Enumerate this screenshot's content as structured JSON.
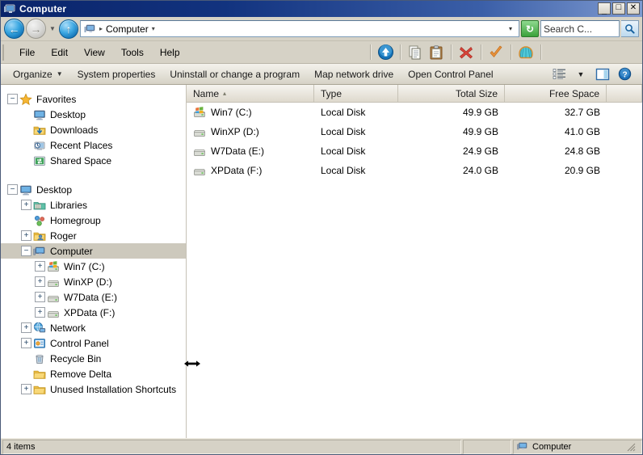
{
  "window": {
    "title": "Computer",
    "title_icon": "computer-monitor-icon",
    "minimize_label": "_",
    "maximize_label": "□",
    "close_label": "✕"
  },
  "address_bar": {
    "back_label": "←",
    "back_name": "back-button",
    "forward_label": "→",
    "forward_name": "forward-button",
    "history_caret": "▼",
    "up_label": "↑",
    "up_name": "up-button",
    "path_icon": "computer-monitor-icon",
    "crumb_sep": "▸",
    "crumb": "Computer",
    "crumb_caret": "▾",
    "dropdown_caret": "▾",
    "refresh_label": "↻",
    "search_value": "Search C...",
    "search_placeholder": "Search Computer",
    "search_button_icon": "magnifier-icon"
  },
  "menu": {
    "items": [
      {
        "label": "File",
        "name": "menu-file"
      },
      {
        "label": "Edit",
        "name": "menu-edit"
      },
      {
        "label": "View",
        "name": "menu-view"
      },
      {
        "label": "Tools",
        "name": "menu-tools"
      },
      {
        "label": "Help",
        "name": "menu-help"
      }
    ],
    "toolbar_icons": [
      {
        "name": "up-folder-icon",
        "glyph": "↑"
      },
      {
        "name": "copy-icon",
        "glyph": "❐"
      },
      {
        "name": "paste-icon",
        "glyph": "ὌB"
      },
      {
        "name": "delete-icon",
        "glyph": "✕"
      },
      {
        "name": "checkmark-icon",
        "glyph": "✓"
      },
      {
        "name": "shell-icon",
        "glyph": "◑"
      }
    ]
  },
  "command_bar": {
    "items": [
      {
        "label": "Organize",
        "name": "organize-button",
        "caret": "▼"
      },
      {
        "label": "System properties",
        "name": "system-properties-button",
        "caret": ""
      },
      {
        "label": "Uninstall or change a program",
        "name": "uninstall-program-button",
        "caret": ""
      },
      {
        "label": "Map network drive",
        "name": "map-network-drive-button",
        "caret": ""
      },
      {
        "label": "Open Control Panel",
        "name": "open-control-panel-button",
        "caret": ""
      }
    ],
    "view_icon": "view-list-icon",
    "view_caret": "▼",
    "preview_icon": "preview-pane-icon",
    "help_icon": "help-icon",
    "help_glyph": "?"
  },
  "nav_pane": {
    "items": [
      {
        "label": "Favorites",
        "name": "tree-item-favorites",
        "icon": "star-icon",
        "expander": "−",
        "indent": 0,
        "selected": false
      },
      {
        "label": "Desktop",
        "name": "tree-item-desktop-favorite",
        "icon": "desktop-icon",
        "expander": "",
        "indent": 1,
        "selected": false
      },
      {
        "label": "Downloads",
        "name": "tree-item-downloads",
        "icon": "downloads-folder-icon",
        "expander": "",
        "indent": 1,
        "selected": false
      },
      {
        "label": "Recent Places",
        "name": "tree-item-recent-places",
        "icon": "recent-places-icon",
        "expander": "",
        "indent": 1,
        "selected": false
      },
      {
        "label": "Shared Space",
        "name": "tree-item-shared-space",
        "icon": "shared-folder-icon",
        "expander": "",
        "indent": 1,
        "selected": false
      },
      {
        "label": "",
        "name": "tree-spacer",
        "icon": "",
        "expander": "",
        "indent": 0,
        "selected": false
      },
      {
        "label": "Desktop",
        "name": "tree-item-desktop-root",
        "icon": "desktop-icon",
        "expander": "−",
        "indent": 0,
        "selected": false
      },
      {
        "label": "Libraries",
        "name": "tree-item-libraries",
        "icon": "libraries-icon",
        "expander": "+",
        "indent": 1,
        "selected": false
      },
      {
        "label": "Homegroup",
        "name": "tree-item-homegroup",
        "icon": "homegroup-icon",
        "expander": "",
        "indent": 1,
        "selected": false
      },
      {
        "label": "Roger",
        "name": "tree-item-roger",
        "icon": "user-folder-icon",
        "expander": "+",
        "indent": 1,
        "selected": false
      },
      {
        "label": "Computer",
        "name": "tree-item-computer",
        "icon": "computer-monitor-icon",
        "expander": "−",
        "indent": 1,
        "selected": true
      },
      {
        "label": "Win7 (C:)",
        "name": "tree-item-win7-c",
        "icon": "windows-drive-icon",
        "expander": "+",
        "indent": 2,
        "selected": false
      },
      {
        "label": "WinXP (D:)",
        "name": "tree-item-winxp-d",
        "icon": "drive-icon",
        "expander": "+",
        "indent": 2,
        "selected": false
      },
      {
        "label": "W7Data (E:)",
        "name": "tree-item-w7data-e",
        "icon": "drive-icon",
        "expander": "+",
        "indent": 2,
        "selected": false
      },
      {
        "label": "XPData (F:)",
        "name": "tree-item-xpdata-f",
        "icon": "drive-icon",
        "expander": "+",
        "indent": 2,
        "selected": false
      },
      {
        "label": "Network",
        "name": "tree-item-network",
        "icon": "network-icon",
        "expander": "+",
        "indent": 1,
        "selected": false
      },
      {
        "label": "Control Panel",
        "name": "tree-item-control-panel",
        "icon": "control-panel-icon",
        "expander": "+",
        "indent": 1,
        "selected": false
      },
      {
        "label": "Recycle Bin",
        "name": "tree-item-recycle-bin",
        "icon": "recycle-bin-icon",
        "expander": "",
        "indent": 1,
        "selected": false
      },
      {
        "label": "Remove Delta",
        "name": "tree-item-remove-delta",
        "icon": "folder-icon",
        "expander": "",
        "indent": 1,
        "selected": false
      },
      {
        "label": "Unused Installation Shortcuts",
        "name": "tree-item-unused-installation-shortcuts",
        "icon": "folder-icon",
        "expander": "+",
        "indent": 1,
        "selected": false
      }
    ]
  },
  "file_list": {
    "columns": [
      {
        "label": "Name",
        "name": "column-header-name",
        "sort": "▴"
      },
      {
        "label": "Type",
        "name": "column-header-type",
        "sort": ""
      },
      {
        "label": "Total Size",
        "name": "column-header-total-size",
        "sort": ""
      },
      {
        "label": "Free Space",
        "name": "column-header-free-space",
        "sort": ""
      }
    ],
    "rows": [
      {
        "name": "Win7 (C:)",
        "type": "Local Disk",
        "total_size": "49.9 GB",
        "free_space": "32.7 GB",
        "icon": "windows-drive-icon"
      },
      {
        "name": "WinXP (D:)",
        "type": "Local Disk",
        "total_size": "49.9 GB",
        "free_space": "41.0 GB",
        "icon": "drive-icon"
      },
      {
        "name": "W7Data (E:)",
        "type": "Local Disk",
        "total_size": "24.9 GB",
        "free_space": "24.8 GB",
        "icon": "drive-icon"
      },
      {
        "name": "XPData (F:)",
        "type": "Local Disk",
        "total_size": "24.0 GB",
        "free_space": "20.9 GB",
        "icon": "drive-icon"
      }
    ]
  },
  "status_bar": {
    "item_count": "4 items",
    "middle": "",
    "location": "Computer",
    "location_icon": "computer-monitor-icon"
  },
  "colors": {
    "title_bar_start": "#0a246a",
    "title_bar_end": "#7e9ad0",
    "chrome": "#d6d2c6",
    "selection": "#cdc9bd",
    "accent_blue": "#1272b5",
    "delete_red": "#d04a3a",
    "check_orange": "#e08a2e",
    "shell_teal": "#3fbfce"
  }
}
